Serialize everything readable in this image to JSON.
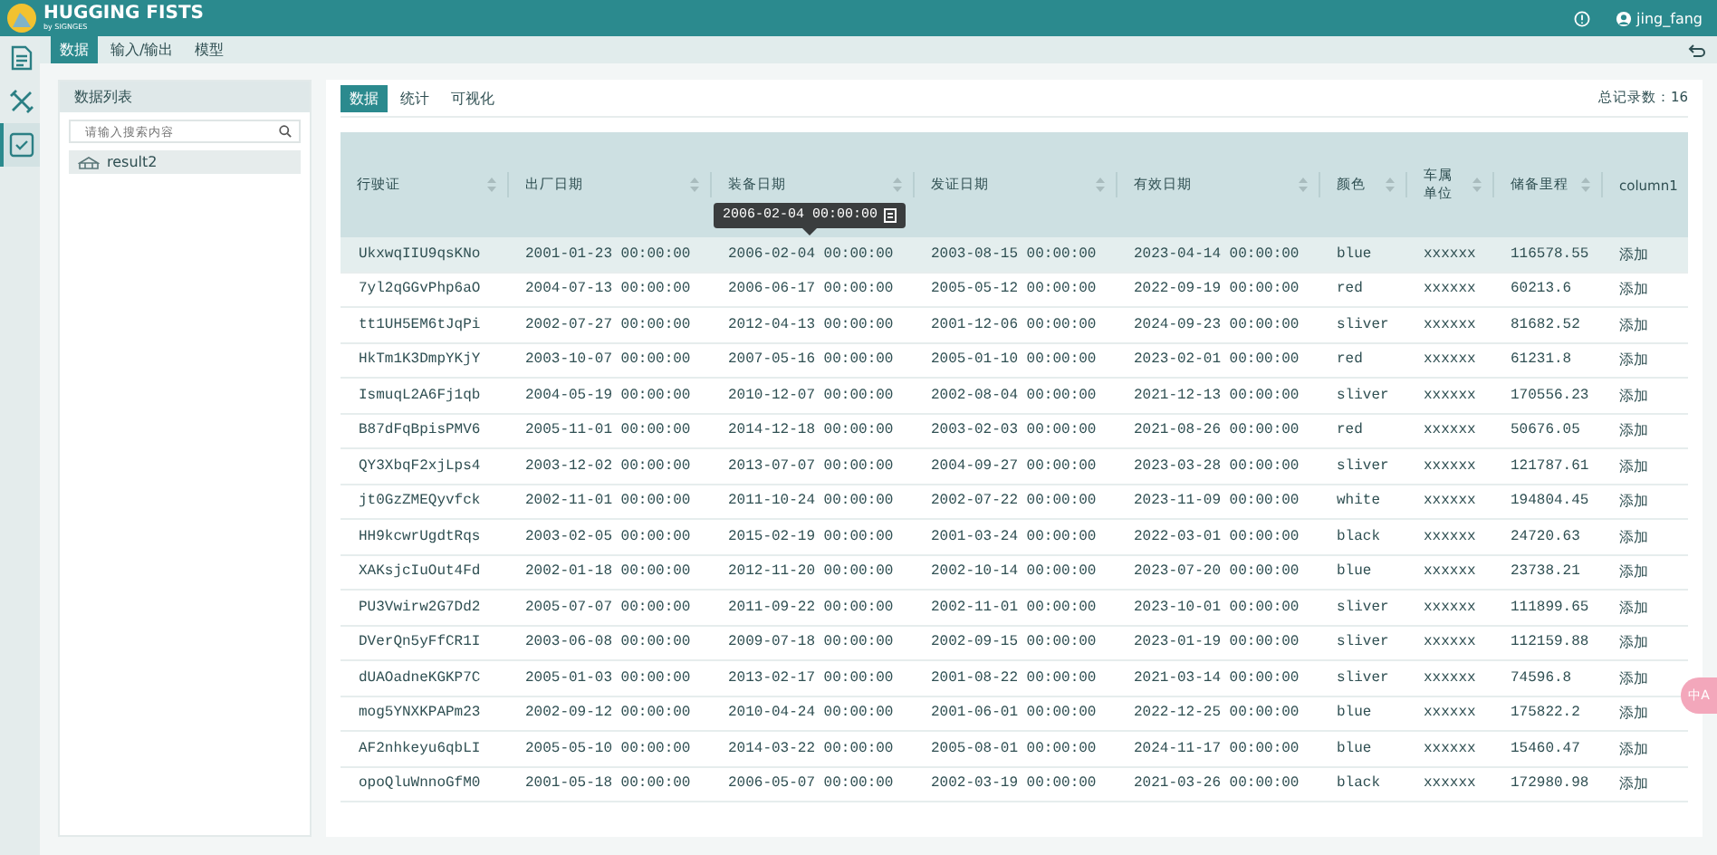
{
  "app": {
    "title": "HUGGING FISTS",
    "subtitle": "by SIGNGES",
    "user": "jing_fang"
  },
  "rail": [
    {
      "kind": "document",
      "selected": false
    },
    {
      "kind": "tools",
      "selected": false
    },
    {
      "kind": "check",
      "selected": true
    }
  ],
  "menu": [
    {
      "label": "数据",
      "selected": true
    },
    {
      "label": "输入/输出",
      "selected": false
    },
    {
      "label": "模型",
      "selected": false
    }
  ],
  "data_list": {
    "title": "数据列表",
    "search": {
      "placeholder": "请输入搜索内容"
    },
    "items": [
      {
        "label": "result2",
        "selected": true
      }
    ]
  },
  "view_tabs": [
    {
      "label": "数据",
      "selected": true
    },
    {
      "label": "统计",
      "selected": false
    },
    {
      "label": "可视化",
      "selected": false
    }
  ],
  "total": "总记录数：16",
  "table": {
    "columns": [
      "行驶证",
      "出厂日期",
      "装备日期",
      "发证日期",
      "有效日期",
      "颜色",
      "车属单位",
      "储备里程",
      "column1"
    ],
    "rows": [
      {
        "highlighted": true,
        "tooltip": "2006-02-04 00:00:00",
        "cells": [
          "UkxwqIIU9qsKNo",
          "2001-01-23 00:00:00",
          "2006-02-04 00:00:00",
          "2003-08-15 00:00:00",
          "2023-04-14 00:00:00",
          "blue",
          "xxxxxx",
          "116578.55",
          "添加"
        ]
      },
      {
        "highlighted": false,
        "cells": [
          "7yl2qGGvPhp6aO",
          "2004-07-13 00:00:00",
          "2006-06-17 00:00:00",
          "2005-05-12 00:00:00",
          "2022-09-19 00:00:00",
          "red",
          "xxxxxx",
          "60213.6",
          "添加"
        ]
      },
      {
        "highlighted": false,
        "cells": [
          "tt1UH5EM6tJqPi",
          "2002-07-27 00:00:00",
          "2012-04-13 00:00:00",
          "2001-12-06 00:00:00",
          "2024-09-23 00:00:00",
          "sliver",
          "xxxxxx",
          "81682.52",
          "添加"
        ]
      },
      {
        "highlighted": false,
        "cells": [
          "HkTm1K3DmpYKjY",
          "2003-10-07 00:00:00",
          "2007-05-16 00:00:00",
          "2005-01-10 00:00:00",
          "2023-02-01 00:00:00",
          "red",
          "xxxxxx",
          "61231.8",
          "添加"
        ]
      },
      {
        "highlighted": false,
        "cells": [
          "IsmuqL2A6Fj1qb",
          "2004-05-19 00:00:00",
          "2010-12-07 00:00:00",
          "2002-08-04 00:00:00",
          "2021-12-13 00:00:00",
          "sliver",
          "xxxxxx",
          "170556.23",
          "添加"
        ]
      },
      {
        "highlighted": false,
        "cells": [
          "B87dFqBpisPMV6",
          "2005-11-01 00:00:00",
          "2014-12-18 00:00:00",
          "2003-02-03 00:00:00",
          "2021-08-26 00:00:00",
          "red",
          "xxxxxx",
          "50676.05",
          "添加"
        ]
      },
      {
        "highlighted": false,
        "cells": [
          "QY3XbqF2xjLps4",
          "2003-12-02 00:00:00",
          "2013-07-07 00:00:00",
          "2004-09-27 00:00:00",
          "2023-03-28 00:00:00",
          "sliver",
          "xxxxxx",
          "121787.61",
          "添加"
        ]
      },
      {
        "highlighted": false,
        "cells": [
          "jt0GzZMEQyvfck",
          "2002-11-01 00:00:00",
          "2011-10-24 00:00:00",
          "2002-07-22 00:00:00",
          "2023-11-09 00:00:00",
          "white",
          "xxxxxx",
          "194804.45",
          "添加"
        ]
      },
      {
        "highlighted": false,
        "cells": [
          "HH9kcwrUgdtRqs",
          "2003-02-05 00:00:00",
          "2015-02-19 00:00:00",
          "2001-03-24 00:00:00",
          "2022-03-01 00:00:00",
          "black",
          "xxxxxx",
          "24720.63",
          "添加"
        ]
      },
      {
        "highlighted": false,
        "cells": [
          "XAKsjcIuOut4Fd",
          "2002-01-18 00:00:00",
          "2012-11-20 00:00:00",
          "2002-10-14 00:00:00",
          "2023-07-20 00:00:00",
          "blue",
          "xxxxxx",
          "23738.21",
          "添加"
        ]
      },
      {
        "highlighted": false,
        "cells": [
          "PU3Vwirw2G7Dd2",
          "2005-07-07 00:00:00",
          "2011-09-22 00:00:00",
          "2002-11-01 00:00:00",
          "2023-10-01 00:00:00",
          "sliver",
          "xxxxxx",
          "111899.65",
          "添加"
        ]
      },
      {
        "highlighted": false,
        "cells": [
          "DVerQn5yFfCR1I",
          "2003-06-08 00:00:00",
          "2009-07-18 00:00:00",
          "2002-09-15 00:00:00",
          "2023-01-19 00:00:00",
          "sliver",
          "xxxxxx",
          "112159.88",
          "添加"
        ]
      },
      {
        "highlighted": false,
        "cells": [
          "dUAOadneKGKP7C",
          "2005-01-03 00:00:00",
          "2013-02-17 00:00:00",
          "2001-08-22 00:00:00",
          "2021-03-14 00:00:00",
          "sliver",
          "xxxxxx",
          "74596.8",
          "添加"
        ]
      },
      {
        "highlighted": false,
        "cells": [
          "mog5YNXKPAPm23",
          "2002-09-12 00:00:00",
          "2010-04-24 00:00:00",
          "2001-06-01 00:00:00",
          "2022-12-25 00:00:00",
          "blue",
          "xxxxxx",
          "175822.2",
          "添加"
        ]
      },
      {
        "highlighted": false,
        "cells": [
          "AF2nhkeyu6qbLI",
          "2005-05-10 00:00:00",
          "2014-03-22 00:00:00",
          "2005-08-01 00:00:00",
          "2024-11-17 00:00:00",
          "blue",
          "xxxxxx",
          "15460.47",
          "添加"
        ]
      },
      {
        "highlighted": false,
        "cells": [
          "opoQluWnnoGfM0",
          "2001-05-18 00:00:00",
          "2006-05-07 00:00:00",
          "2002-03-19 00:00:00",
          "2021-03-26 00:00:00",
          "black",
          "xxxxxx",
          "172980.98",
          "添加"
        ]
      }
    ]
  },
  "translate_button": {
    "label": "中A"
  }
}
